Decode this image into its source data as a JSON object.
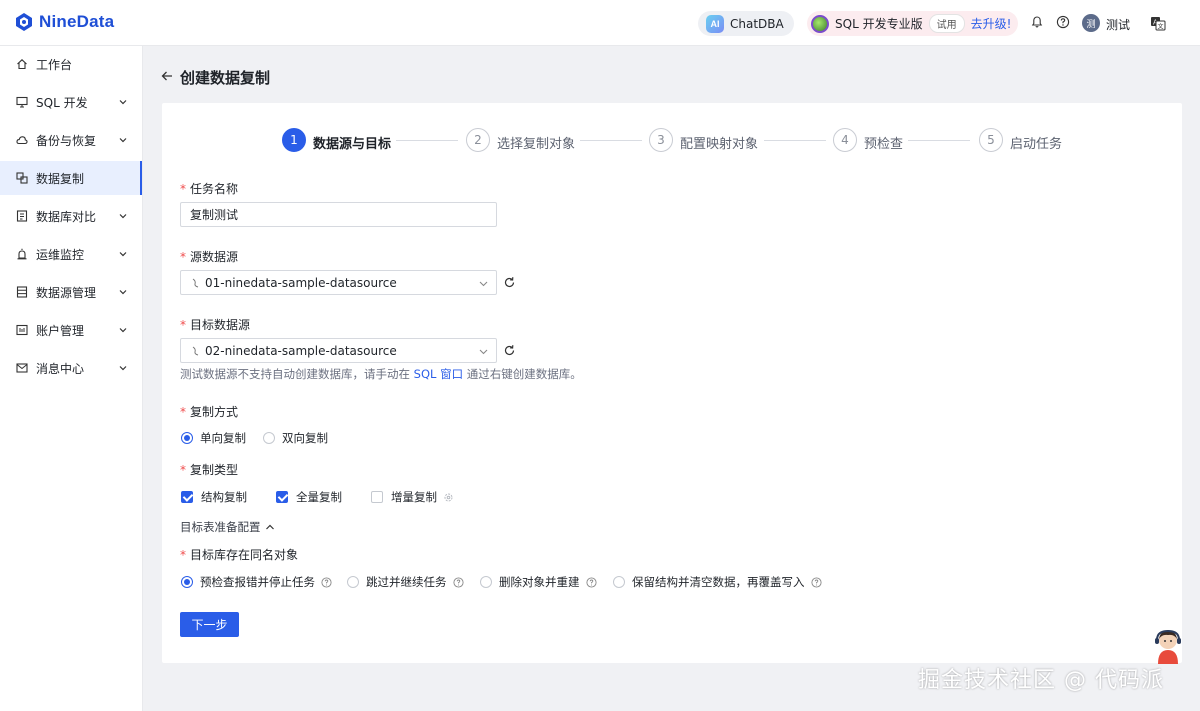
{
  "app": {
    "brand": "NineData",
    "brand_color": "#1f4fd6",
    "accent_color": "#2a5de8"
  },
  "header": {
    "chatdba_icon_text": "AI",
    "chatdba_label": "ChatDBA",
    "sqlpro_label": "SQL 开发专业版",
    "trial_tag": "试用",
    "upgrade_label": "去升级!",
    "user_avatar_text": "测",
    "user_name": "测试",
    "icons": [
      "bell-icon",
      "help-icon",
      "language-icon"
    ]
  },
  "sidebar": {
    "items": [
      {
        "label": "工作台",
        "icon": "home-icon",
        "expandable": false,
        "active": false
      },
      {
        "label": "SQL 开发",
        "icon": "monitor-icon",
        "expandable": true,
        "active": false
      },
      {
        "label": "备份与恢复",
        "icon": "cloud-icon",
        "expandable": true,
        "active": false
      },
      {
        "label": "数据复制",
        "icon": "copy-icon",
        "expandable": false,
        "active": true
      },
      {
        "label": "数据库对比",
        "icon": "compare-icon",
        "expandable": true,
        "active": false
      },
      {
        "label": "运维监控",
        "icon": "alarm-icon",
        "expandable": true,
        "active": false
      },
      {
        "label": "数据源管理",
        "icon": "database-icon",
        "expandable": true,
        "active": false
      },
      {
        "label": "账户管理",
        "icon": "account-icon",
        "expandable": true,
        "active": false
      },
      {
        "label": "消息中心",
        "icon": "mail-icon",
        "expandable": true,
        "active": false
      }
    ]
  },
  "page": {
    "title": "创建数据复制"
  },
  "steps": [
    {
      "num": "1",
      "label": "数据源与目标",
      "active": true
    },
    {
      "num": "2",
      "label": "选择复制对象",
      "active": false
    },
    {
      "num": "3",
      "label": "配置映射对象",
      "active": false
    },
    {
      "num": "4",
      "label": "预检查",
      "active": false
    },
    {
      "num": "5",
      "label": "启动任务",
      "active": false
    }
  ],
  "form": {
    "required_mark": "*",
    "task_name": {
      "label": "任务名称",
      "value": "复制测试"
    },
    "source": {
      "label": "源数据源",
      "value": "01-ninedata-sample-datasource"
    },
    "target": {
      "label": "目标数据源",
      "value": "02-ninedata-sample-datasource"
    },
    "hint": {
      "before": "测试数据源不支持自动创建数据库，请手动在 ",
      "link": "SQL 窗口",
      "after": " 通过右键创建数据库。"
    },
    "copy_mode": {
      "label": "复制方式",
      "options": [
        {
          "label": "单向复制",
          "selected": true
        },
        {
          "label": "双向复制",
          "selected": false
        }
      ]
    },
    "copy_type": {
      "label": "复制类型",
      "options": [
        {
          "label": "结构复制",
          "checked": true
        },
        {
          "label": "全量复制",
          "checked": true
        },
        {
          "label": "增量复制",
          "checked": false
        }
      ]
    },
    "target_prep": {
      "label": "目标表准备配置"
    },
    "same_name": {
      "label": "目标库存在同名对象",
      "options": [
        {
          "label": "预检查报错并停止任务",
          "selected": true
        },
        {
          "label": "跳过并继续任务",
          "selected": false
        },
        {
          "label": "删除对象并重建",
          "selected": false
        },
        {
          "label": "保留结构并清空数据，再覆盖写入",
          "selected": false
        }
      ]
    },
    "next_button": "下一步"
  },
  "watermark": "掘金技术社区 @ 代码派"
}
